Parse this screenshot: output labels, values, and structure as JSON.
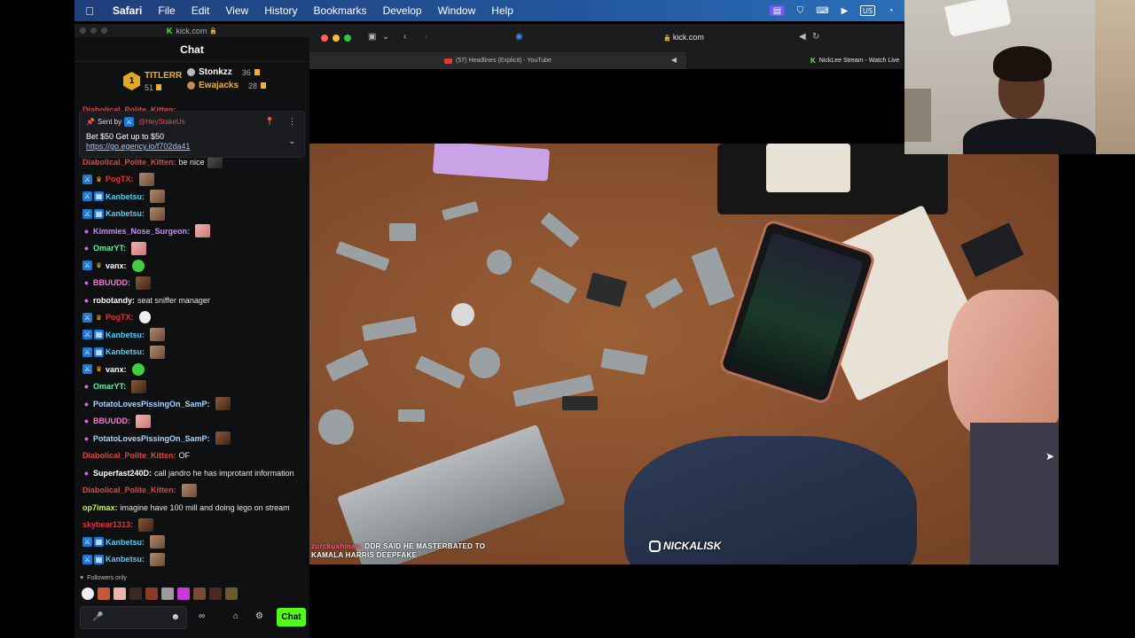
{
  "menubar": {
    "apple": "",
    "items": [
      "Safari",
      "File",
      "Edit",
      "View",
      "History",
      "Bookmarks",
      "Develop",
      "Window",
      "Help"
    ],
    "keyboard": "US"
  },
  "chat_window": {
    "url": "kick.com",
    "header": "Chat",
    "leaderboard": {
      "first": {
        "rank": "1",
        "name": "TITLERR",
        "count": "51"
      },
      "second": {
        "name": "Stonkzz",
        "count": "36"
      },
      "third": {
        "name": "Ewajacks",
        "count": "28"
      }
    },
    "pinned": {
      "sent_by_label": "Sent by",
      "sent_by_user": "@HeyStakeUs",
      "text": "Bet $50 Get up to $50",
      "link": "https://go.egency.io/f702da41"
    },
    "top_partial_user": "Diabolical_Polite_Kitten:",
    "messages": [
      {
        "user": "Diabolical_Polite_Kitten:",
        "color": "#e0473f",
        "badges": [],
        "text": "be nice",
        "emote": "e-dark"
      },
      {
        "user": "PogTX:",
        "color": "#e2353c",
        "badges": [
          "mod",
          "crown"
        ],
        "text": "",
        "emote": "e-cat"
      },
      {
        "user": "Kanbetsu:",
        "color": "#4fd0f5",
        "badges": [
          "mod",
          "sub"
        ],
        "text": "",
        "emote": "e-cat"
      },
      {
        "user": "Kanbetsu:",
        "color": "#4fd0f5",
        "badges": [
          "mod",
          "sub"
        ],
        "text": "",
        "emote": "e-cat"
      },
      {
        "user": "Kimmies_Nose_Surgeon:",
        "color": "#c58ef5",
        "badges": [
          "gift"
        ],
        "text": "",
        "emote": "e-pink"
      },
      {
        "user": "OmarYT:",
        "color": "#5ff2a6",
        "badges": [
          "gift"
        ],
        "text": "",
        "emote": "e-pink"
      },
      {
        "user": "vanx:",
        "color": "#ffffff",
        "badges": [
          "mod",
          "crown"
        ],
        "text": "",
        "emote": "e-green"
      },
      {
        "user": "BBUUDD:",
        "color": "#f27bd0",
        "badges": [
          "gift"
        ],
        "text": "",
        "emote": "e-face"
      },
      {
        "user": "robotandy:",
        "color": "#ffffff",
        "badges": [
          "gift"
        ],
        "text": "seat sniffer manager",
        "emote": ""
      },
      {
        "user": "PogTX:",
        "color": "#e2353c",
        "badges": [
          "mod",
          "crown"
        ],
        "text": "",
        "emote": "e-white"
      },
      {
        "user": "Kanbetsu:",
        "color": "#4fd0f5",
        "badges": [
          "mod",
          "sub"
        ],
        "text": "",
        "emote": "e-cat"
      },
      {
        "user": "Kanbetsu:",
        "color": "#4fd0f5",
        "badges": [
          "mod",
          "sub"
        ],
        "text": "",
        "emote": "e-cat"
      },
      {
        "user": "vanx:",
        "color": "#ffffff",
        "badges": [
          "mod",
          "crown"
        ],
        "text": "",
        "emote": "e-green"
      },
      {
        "user": "OmarYT:",
        "color": "#5ff2a6",
        "badges": [
          "gift"
        ],
        "text": "",
        "emote": "e-face"
      },
      {
        "user": "PotatoLovesPissingOn_SamP:",
        "color": "#a9d8ff",
        "badges": [
          "gift"
        ],
        "text": "",
        "emote": "e-face"
      },
      {
        "user": "BBUUDD:",
        "color": "#f27bd0",
        "badges": [
          "gift"
        ],
        "text": "",
        "emote": "e-pink"
      },
      {
        "user": "PotatoLovesPissingOn_SamP:",
        "color": "#a9d8ff",
        "badges": [
          "gift"
        ],
        "text": "",
        "emote": "e-face"
      },
      {
        "user": "Diabolical_Polite_Kitten:",
        "color": "#e0473f",
        "badges": [],
        "text": "OF",
        "emote": ""
      },
      {
        "user": "Superfast240D:",
        "color": "#ffffff",
        "badges": [
          "gift"
        ],
        "text": "call jandro he has improtant information",
        "emote": ""
      },
      {
        "user": "Diabolical_Polite_Kitten:",
        "color": "#e0473f",
        "badges": [],
        "text": "",
        "emote": "e-cat"
      },
      {
        "user": "op7imax:",
        "color": "#c8f54a",
        "badges": [],
        "text": "imagine have 100 mill and doing lego on stream",
        "emote": ""
      },
      {
        "user": "skybear1313:",
        "color": "#e2353c",
        "badges": [],
        "text": "",
        "emote": "e-face"
      },
      {
        "user": "Kanbetsu:",
        "color": "#4fd0f5",
        "badges": [
          "mod",
          "sub"
        ],
        "text": "",
        "emote": "e-cat"
      },
      {
        "user": "Kanbetsu:",
        "color": "#4fd0f5",
        "badges": [
          "mod",
          "sub"
        ],
        "text": "",
        "emote": "e-cat"
      }
    ],
    "followers_only": "Followers only",
    "send_label": "Chat"
  },
  "safari": {
    "address": "kick.com",
    "tab_youtube": "(57) Headlines (Explicit) - YouTube",
    "tab_kick": "NickLee Stream - Watch Live"
  },
  "video": {
    "subtitle_user": "zurckushman:",
    "subtitle_line1": "DDR SAID HE MASTERBATED TO",
    "subtitle_line2": "KAMALA HARRIS DEEPFAKE",
    "watermark": "NICKALISK"
  },
  "colors": {
    "kick_green": "#53fc18",
    "gold": "#f4b02a"
  }
}
